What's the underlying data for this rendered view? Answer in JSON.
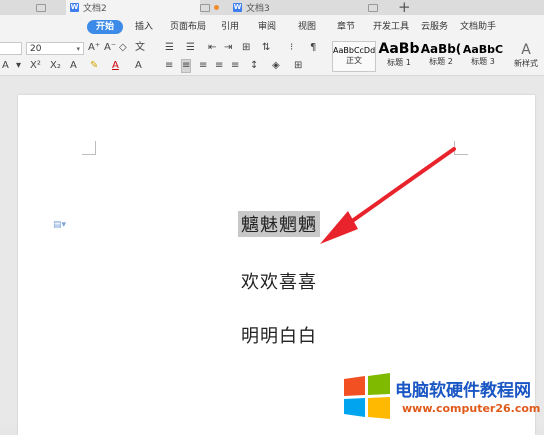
{
  "tabs": [
    {
      "label": "文档2",
      "active": false
    },
    {
      "label": "文档3",
      "active": true
    }
  ],
  "menu": {
    "items": [
      "开始",
      "插入",
      "页面布局",
      "引用",
      "审阅",
      "视图",
      "章节",
      "开发工具",
      "云服务",
      "文档助手"
    ],
    "active": "开始",
    "accent": "#3d8be8"
  },
  "ribbon": {
    "font_size": "20",
    "row2": [
      "A",
      "X²",
      "X₂",
      "A",
      "A",
      "A"
    ],
    "styles": [
      {
        "preview": "AaBbCcDd",
        "name": "正文"
      },
      {
        "preview": "AaBb",
        "name": "标题 1"
      },
      {
        "preview": "AaBb(",
        "name": "标题 2"
      },
      {
        "preview": "AaBbC",
        "name": "标题 3"
      }
    ],
    "new_style": "新样式"
  },
  "document": {
    "paragraphs": [
      {
        "text": "魑魅魍魉",
        "selected": true
      },
      {
        "text": "欢欢喜喜",
        "selected": false
      },
      {
        "text": "明明白白",
        "selected": false
      }
    ],
    "arrow_color": "#e8232b"
  },
  "watermark": {
    "title": "电脑软硬件教程网",
    "url": "www.computer26.com"
  }
}
